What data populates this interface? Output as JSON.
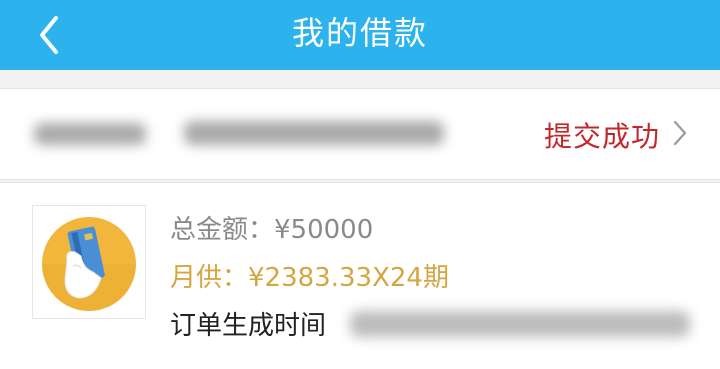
{
  "header": {
    "title": "我的借款",
    "back_icon": "chevron-left-icon",
    "background": "#2cb2ed"
  },
  "status_row": {
    "status_text": "提交成功",
    "status_color": "#c1272d",
    "chevron_icon": "chevron-right-icon"
  },
  "order": {
    "thumb_icon": "card-in-hand-icon",
    "total_label": "总金额：",
    "total_value": "¥50000",
    "monthly_label": "月供：",
    "monthly_value": "¥2383.33X24期",
    "time_label": "订单生成时间",
    "monthly_color": "#d4a640"
  }
}
